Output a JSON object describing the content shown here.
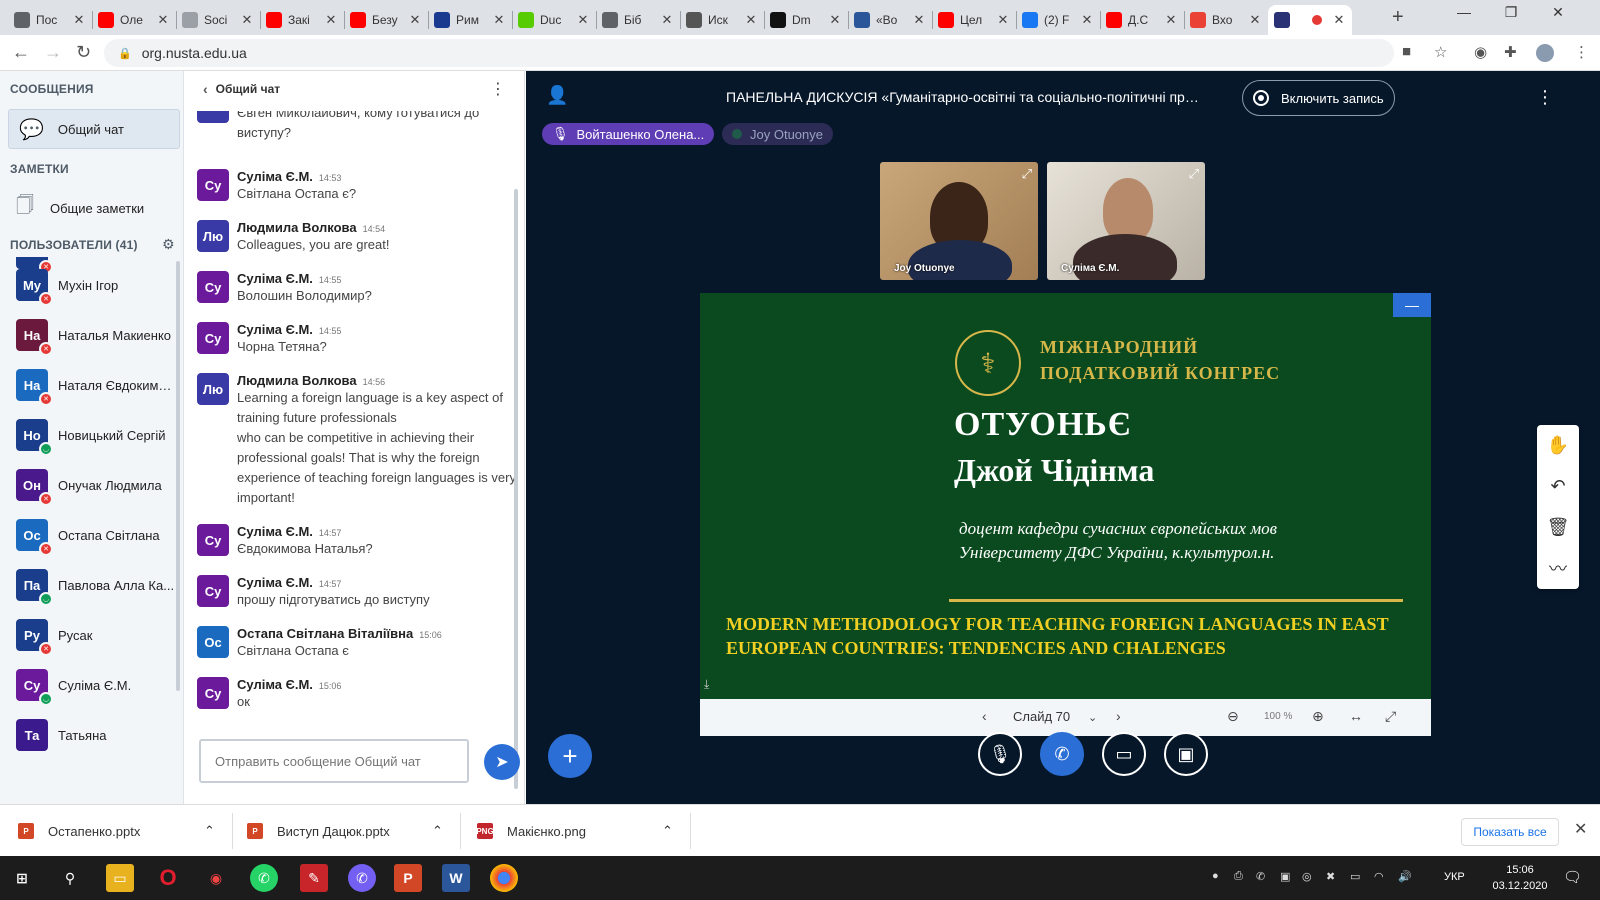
{
  "browser": {
    "tabs": [
      {
        "title": "Пос",
        "icon": "globe-icon",
        "color": "#5f6368"
      },
      {
        "title": "Оле",
        "icon": "youtube-icon",
        "color": "#ff0000"
      },
      {
        "title": "Soci",
        "icon": "globe-icon",
        "color": "#9aa0a6"
      },
      {
        "title": "Закі",
        "icon": "youtube-icon",
        "color": "#ff0000"
      },
      {
        "title": "Безу",
        "icon": "youtube-icon",
        "color": "#ff0000"
      },
      {
        "title": "Рим",
        "icon": "pk-icon",
        "color": "#1a3a8f"
      },
      {
        "title": "Duc",
        "icon": "duolingo-icon",
        "color": "#58cc02"
      },
      {
        "title": "Біб",
        "icon": "globe-icon",
        "color": "#5f6368"
      },
      {
        "title": "Иск",
        "icon": "e-icon",
        "color": "#555555"
      },
      {
        "title": "Dm",
        "icon": "a-icon",
        "color": "#111111"
      },
      {
        "title": "«Во",
        "icon": "word-icon",
        "color": "#2b579a"
      },
      {
        "title": "Цел",
        "icon": "youtube-icon",
        "color": "#ff0000"
      },
      {
        "title": "(2) F",
        "icon": "facebook-icon",
        "color": "#1877f2"
      },
      {
        "title": "Д.С",
        "icon": "youtube-icon",
        "color": "#ff0000"
      },
      {
        "title": "Вхо",
        "icon": "gmail-icon",
        "color": "#ea4335"
      },
      {
        "title": "",
        "icon": "bigbluebutton-icon",
        "color": "#283274",
        "active": true
      }
    ],
    "url": "org.nusta.edu.ua"
  },
  "sidebar": {
    "messages_heading": "СООБЩЕНИЯ",
    "public_chat": "Общий чат",
    "notes_heading": "ЗАМЕТКИ",
    "shared_notes": "Общие заметки",
    "users_heading": "ПОЛЬЗОВАТЕЛИ (41)",
    "users": [
      {
        "initials": "Му",
        "name": "Мухін Ігор",
        "color": "#1a3d8c",
        "status": "muted"
      },
      {
        "initials": "На",
        "name": "Наталья Макиенко",
        "color": "#6b1a3d",
        "status": "muted"
      },
      {
        "initials": "На",
        "name": "Наталя Євдокимова",
        "color": "#1a6bbf",
        "status": "muted"
      },
      {
        "initials": "Но",
        "name": "Новицький Сергій",
        "color": "#1a3d8c",
        "status": "listen"
      },
      {
        "initials": "Он",
        "name": "Онучак Людмила",
        "color": "#4a1a8c",
        "status": "muted"
      },
      {
        "initials": "Ос",
        "name": "Остапа Світлана",
        "color": "#1a6bbf",
        "status": "muted"
      },
      {
        "initials": "Па",
        "name": "Павлова Алла Ка...",
        "color": "#1a3d8c",
        "status": "listen"
      },
      {
        "initials": "Ру",
        "name": "Русак",
        "color": "#1a3d8c",
        "status": "muted"
      },
      {
        "initials": "Су",
        "name": "Суліма Є.М.",
        "color": "#6b1a9c",
        "status": "listen"
      },
      {
        "initials": "Та",
        "name": "Татьяна",
        "color": "#3a1a8c",
        "status": ""
      }
    ]
  },
  "chat": {
    "title": "Общий чат",
    "top_partial": "Євген Миколайович, кому готуватися до виступу?",
    "messages": [
      {
        "initials": "Су",
        "color": "#6b1a9c",
        "author": "Суліма Є.М.",
        "time": "14:53",
        "lines": [
          "Світлана Остапа є?"
        ]
      },
      {
        "initials": "Лю",
        "color": "#3a3aa6",
        "author": "Людмила Волкова",
        "time": "14:54",
        "lines": [
          "Colleagues, you are great!"
        ]
      },
      {
        "initials": "Су",
        "color": "#6b1a9c",
        "author": "Суліма Є.М.",
        "time": "14:55",
        "lines": [
          "Волошин Володимир?"
        ]
      },
      {
        "initials": "Су",
        "color": "#6b1a9c",
        "author": "Суліма Є.М.",
        "time": "14:55",
        "lines": [
          "Чорна Тетяна?"
        ]
      },
      {
        "initials": "Лю",
        "color": "#3a3aa6",
        "author": "Людмила Волкова",
        "time": "14:56",
        "lines": [
          "Learning a foreign language is a key aspect of",
          "training future professionals",
          "who can be competitive in achieving their",
          "professional goals! That is why the foreign",
          "experience of teaching foreign languages is very",
          "important!"
        ]
      },
      {
        "initials": "Су",
        "color": "#6b1a9c",
        "author": "Суліма Є.М.",
        "time": "14:57",
        "lines": [
          "Євдокимова Наталья?"
        ]
      },
      {
        "initials": "Су",
        "color": "#6b1a9c",
        "author": "Суліма Є.М.",
        "time": "14:57",
        "lines": [
          "прошу підготуватись до виступу"
        ]
      },
      {
        "initials": "Ос",
        "color": "#1a6bbf",
        "author": "Остапа Світлана Віталіївна",
        "time": "15:06",
        "lines": [
          "Світлана Остапа є"
        ]
      },
      {
        "initials": "Су",
        "color": "#6b1a9c",
        "author": "Суліма Є.М.",
        "time": "15:06",
        "lines": [
          "ок"
        ]
      }
    ],
    "input_placeholder": "Отправить сообщение Общий чат"
  },
  "meeting": {
    "title": "ПАНЕЛЬНА ДИСКУСІЯ «Гуманітарно-освітні та соціально-політичні проц...",
    "record_label": "Включить запись",
    "talkers": [
      "Войташенко Олена...",
      "Joy Otuonye"
    ],
    "videos": [
      {
        "name": "Joy Otuonye"
      },
      {
        "name": "Суліма Є.М."
      }
    ],
    "slide": {
      "congress_line1": "МІЖНАРОДНИЙ",
      "congress_line2": "ПОДАТКОВИЙ КОНГРЕС",
      "speaker_surname": "ОТУОНЬЄ",
      "speaker_given": "Джой Чідінма",
      "position_line1": "доцент кафедри сучасних європейських мов",
      "position_line2": "Університету ДФС України, к.культурол.н.",
      "topic": "MODERN METHODOLOGY FOR TEACHING FOREIGN LANGUAGES IN EAST EUROPEAN COUNTRIES: TENDENCIES AND CHALENGES"
    },
    "slide_label": "Слайд 70",
    "zoom": "100 %"
  },
  "downloads": [
    {
      "name": "Остапенко.pptx",
      "type": "pptx",
      "color": "#d24726"
    },
    {
      "name": "Виступ Дацюк.pptx",
      "type": "pptx",
      "color": "#d24726"
    },
    {
      "name": "Макієнко.png",
      "type": "png",
      "color": "#c1272d"
    }
  ],
  "downloads_show_all": "Показать все",
  "taskbar": {
    "lang": "УКР",
    "time": "15:06",
    "date": "03.12.2020"
  }
}
